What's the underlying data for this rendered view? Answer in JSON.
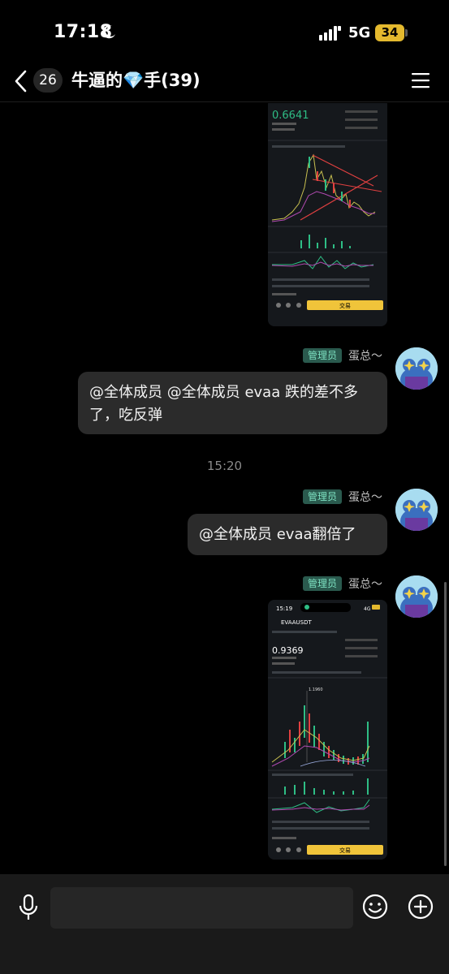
{
  "status": {
    "time": "17:18",
    "network": "5G",
    "battery": "34"
  },
  "header": {
    "unread_count": "26",
    "group_title": "牛逼的💎手(39)"
  },
  "messages": {
    "msg1": {
      "sender_badge": "管理员",
      "sender_name": "蛋总～",
      "text": "@全体成员 @全体成员 evaa 跌的差不多了，吃反弹"
    },
    "time_separator": "15:20",
    "msg2": {
      "sender_badge": "管理员",
      "sender_name": "蛋总～",
      "text": "@全体成员 evaa翻倍了"
    },
    "msg3": {
      "sender_badge": "管理员",
      "sender_name": "蛋总～"
    }
  },
  "screenshot1": {
    "price": "0.6641",
    "action_button": "交易"
  },
  "screenshot2": {
    "status_time": "15:19",
    "status_network": "4G",
    "symbol": "EVAAUSDT",
    "price": "0.9369",
    "peak_label": "1.1960",
    "action_button": "交易"
  },
  "input": {
    "placeholder": ""
  },
  "icons": {
    "back": "chevron-left-icon",
    "menu": "hamburger-menu-icon",
    "mic": "microphone-icon",
    "emoji": "smiley-icon",
    "plus": "plus-circle-icon"
  },
  "colors": {
    "background": "#000000",
    "bubble": "#2b2b2b",
    "badge_bg": "#2a5a4e",
    "badge_text": "#7ee2c2",
    "battery": "#e4b92e",
    "buy_yellow": "#f0c43a",
    "price_green": "#2ebd85"
  }
}
